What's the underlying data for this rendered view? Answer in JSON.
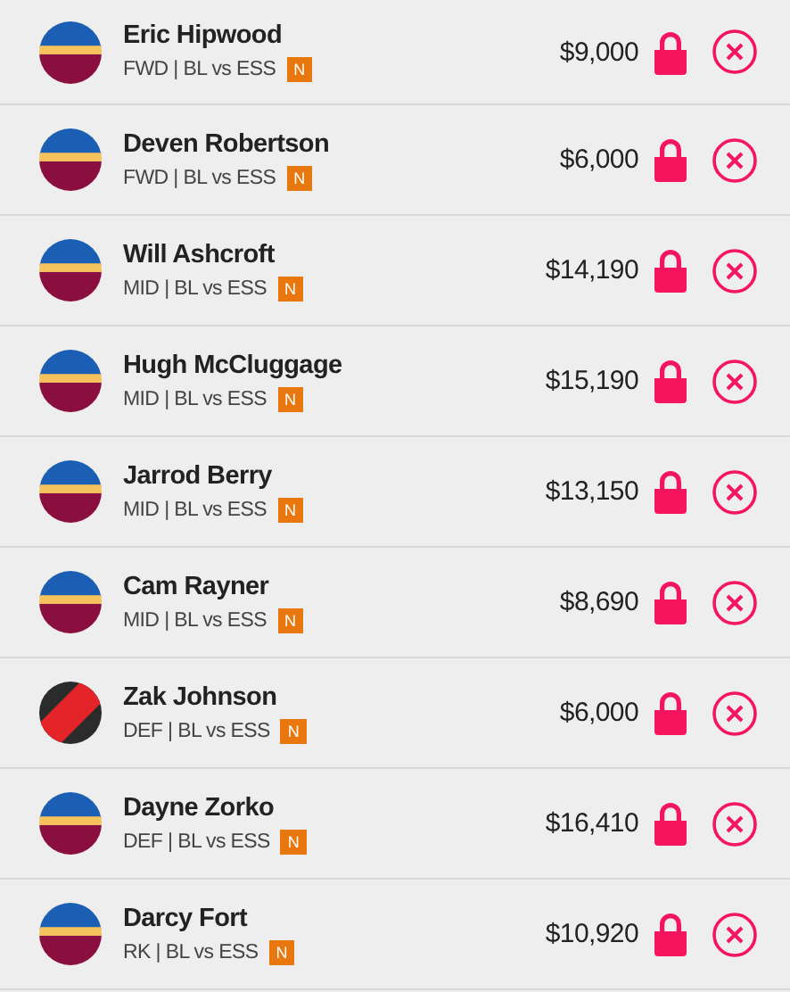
{
  "players": [
    {
      "name": "Eric Hipwood",
      "meta": "FWD | BL vs ESS",
      "badge": "N",
      "kind": "brisbane",
      "price": "$9,000"
    },
    {
      "name": "Deven Robertson",
      "meta": "FWD | BL vs ESS",
      "badge": "N",
      "kind": "brisbane",
      "price": "$6,000"
    },
    {
      "name": "Will Ashcroft",
      "meta": "MID | BL vs ESS",
      "badge": "N",
      "kind": "brisbane",
      "price": "$14,190"
    },
    {
      "name": "Hugh McCluggage",
      "meta": "MID | BL vs ESS",
      "badge": "N",
      "kind": "brisbane",
      "price": "$15,190"
    },
    {
      "name": "Jarrod Berry",
      "meta": "MID | BL vs ESS",
      "badge": "N",
      "kind": "brisbane",
      "price": "$13,150"
    },
    {
      "name": "Cam Rayner",
      "meta": "MID | BL vs ESS",
      "badge": "N",
      "kind": "brisbane",
      "price": "$8,690"
    },
    {
      "name": "Zak Johnson",
      "meta": "DEF | BL vs ESS",
      "badge": "N",
      "kind": "essendon",
      "price": "$6,000"
    },
    {
      "name": "Dayne Zorko",
      "meta": "DEF | BL vs ESS",
      "badge": "N",
      "kind": "brisbane",
      "price": "$16,410"
    },
    {
      "name": "Darcy Fort",
      "meta": "RK | BL vs ESS",
      "badge": "N",
      "kind": "brisbane",
      "price": "$10,920"
    }
  ]
}
